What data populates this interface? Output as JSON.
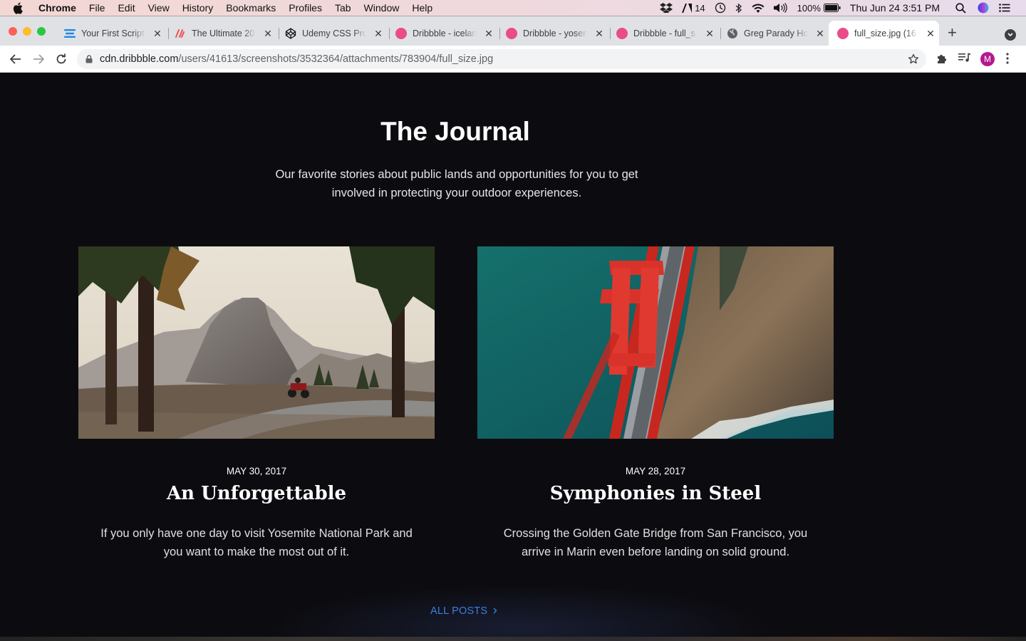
{
  "menubar": {
    "app_name": "Chrome",
    "items": [
      "File",
      "Edit",
      "View",
      "History",
      "Bookmarks",
      "Profiles",
      "Tab",
      "Window",
      "Help"
    ],
    "adobe_count": "14",
    "battery": "100%",
    "clock": "Thu Jun 24  3:51 PM"
  },
  "tabs": [
    {
      "label": "Your First Script",
      "icon": "stack-icon",
      "color": "#1e88e5"
    },
    {
      "label": "The Ultimate 20",
      "icon": "udemy-u-icon",
      "color": "#ec5252"
    },
    {
      "label": "Udemy CSS Pro",
      "icon": "codepen-icon",
      "color": "#000000"
    },
    {
      "label": "Dribbble - icelan",
      "icon": "dribbble-icon",
      "color": "#ea4c89"
    },
    {
      "label": "Dribbble - yosen",
      "icon": "dribbble-icon",
      "color": "#ea4c89"
    },
    {
      "label": "Dribbble - full_s",
      "icon": "dribbble-icon",
      "color": "#ea4c89"
    },
    {
      "label": "Greg Parady Ho",
      "icon": "globe-icon",
      "color": "#5f6368"
    },
    {
      "label": "full_size.jpg (16",
      "icon": "dribbble-icon",
      "color": "#ea4c89",
      "active": true
    }
  ],
  "address": {
    "host": "cdn.dribbble.com",
    "path": "/users/41613/screenshots/3532364/attachments/783904/full_size.jpg"
  },
  "profile_initial": "M",
  "page": {
    "title": "The Journal",
    "subtitle": "Our favorite stories about public lands and opportunities for you to get involved in protecting your outdoor experiences.",
    "cards": [
      {
        "date": "MAY 30, 2017",
        "title": "An Unforgettable",
        "description": "If you only have one day to visit Yosemite National Park and you want to make the most out of it.",
        "image": "yosemite-half-dome-motorcycle"
      },
      {
        "date": "MAY 28, 2017",
        "title": "Symphonies in Steel",
        "description": "Crossing the Golden Gate Bridge from San Francisco, you arrive in Marin even before landing on solid ground.",
        "image": "golden-gate-bridge-aerial"
      }
    ],
    "all_posts_label": "ALL POSTS",
    "accent_color": "#3d7ee0"
  }
}
